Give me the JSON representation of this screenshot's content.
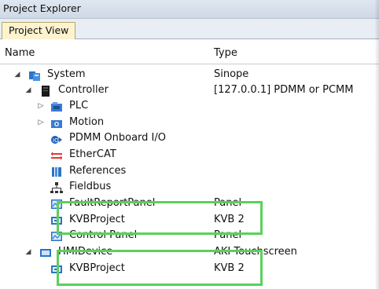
{
  "window": {
    "title": "Project Explorer"
  },
  "tabs": [
    {
      "label": "Project View"
    }
  ],
  "columns": {
    "name": "Name",
    "type": "Type"
  },
  "tree": [
    {
      "name": "System",
      "type": "Sinope",
      "icon": "system-icon",
      "expander": "expanded"
    },
    {
      "name": "Controller",
      "type": "[127.0.0.1] PDMM or PCMM",
      "icon": "controller-icon",
      "expander": "expanded"
    },
    {
      "name": "PLC",
      "type": "",
      "icon": "plc-icon",
      "expander": "collapsed"
    },
    {
      "name": "Motion",
      "type": "",
      "icon": "motion-icon",
      "expander": "collapsed"
    },
    {
      "name": "PDMM Onboard I/O",
      "type": "",
      "icon": "onboard-io-icon",
      "expander": "none"
    },
    {
      "name": "EtherCAT",
      "type": "",
      "icon": "ethercat-icon",
      "expander": "none"
    },
    {
      "name": "References",
      "type": "",
      "icon": "references-icon",
      "expander": "none"
    },
    {
      "name": "Fieldbus",
      "type": "",
      "icon": "fieldbus-icon",
      "expander": "none"
    },
    {
      "name": "FaultReportPanel",
      "type": "Panel",
      "icon": "panel-icon",
      "expander": "none"
    },
    {
      "name": "KVBProject",
      "type": "KVB 2",
      "icon": "kvb-project-icon",
      "expander": "none"
    },
    {
      "name": "Control Panel",
      "type": "Panel",
      "icon": "panel-icon",
      "expander": "none"
    },
    {
      "name": "HMIDevice",
      "type": "AKI Touchscreen",
      "icon": "hmi-device-icon",
      "expander": "expanded"
    },
    {
      "name": "KVBProject",
      "type": "KVB 2",
      "icon": "kvb-project-icon",
      "expander": "none"
    }
  ],
  "highlight_color": "#5bd05b"
}
